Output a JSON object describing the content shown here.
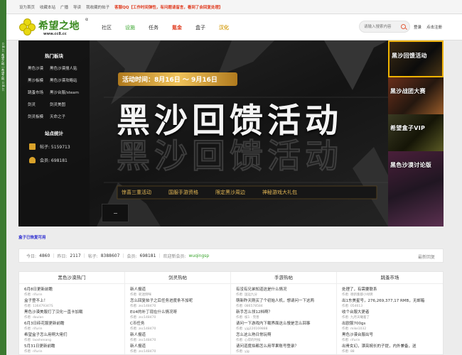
{
  "side_strip": {
    "text": "cc8.cc 希望之地 | 希望之地 cc8.cc"
  },
  "topbar": {
    "items": [
      "设为首页",
      "收藏本站",
      "广播",
      "导读",
      "我收藏的帖子"
    ],
    "notice": "客服QQ【工作时间弹性，有问题请留言，看到了会回复处理】"
  },
  "logo": {
    "name": "希望之地",
    "url": "www.cc8.cc",
    "alpha": "α"
  },
  "nav": {
    "items": [
      {
        "label": "社区",
        "style": "item"
      },
      {
        "label": "设施",
        "style": "active"
      },
      {
        "label": "任务",
        "style": "item"
      },
      {
        "label": "氪金",
        "style": "gold"
      },
      {
        "label": "盒子",
        "style": "item"
      },
      {
        "label": "汉化",
        "style": "hanhua"
      }
    ]
  },
  "search": {
    "placeholder": "请输入搜索内容"
  },
  "auth": {
    "login": "登录",
    "register": "点击注册"
  },
  "hotpanel": {
    "title": "热门板块",
    "links": [
      "黑色沙漠",
      "黑色沙漠搜人贴",
      "黑沙板模",
      "黑色沙漠攻略站",
      "跳蚤市场",
      "黑沙台服/steam",
      "剑灵",
      "剑灵美图",
      "剑灵板模",
      "天命之子"
    ],
    "stats_title": "站点统计",
    "posts_label": "帖子: 5159713",
    "members_label": "会员: 698181"
  },
  "hero": {
    "time": "活动时间：8月16日 ～ 9月16日",
    "headline": "黑沙回馈活动",
    "perks": [
      "惊喜三重活动",
      "国服手游资格",
      "限定黑沙周边",
      "神秘游戏大礼包"
    ]
  },
  "thumbs": [
    {
      "title": "黑沙回馈活动",
      "selected": true
    },
    {
      "title": "黑沙战团大赛",
      "selected": false
    },
    {
      "title": "希望盒子VIP",
      "selected": false
    },
    {
      "title": "黑色沙漠讨论版",
      "selected": false
    }
  ],
  "box_notice": "盒子已恢复可用",
  "statsbar": {
    "today_label": "今日:",
    "today": "4860",
    "yesterday_label": "昨日:",
    "yesterday": "2117",
    "posts_label": "帖子:",
    "posts": "8388607",
    "members_label": "会员:",
    "members": "698181",
    "welcome": "欢迎新会员:",
    "new_member": "wuqingsp",
    "latest": "最新回复"
  },
  "columns": [
    {
      "title": "黑色沙漠热门",
      "posts": [
        {
          "t": "6月8日更新前瞻",
          "a": "作者: rifurin"
        },
        {
          "t": "盒子登不上！",
          "a": "作者: 136479347S"
        },
        {
          "t": "黑色沙漠美服打了汉化一直卡加载",
          "a": "作者: doulan"
        },
        {
          "t": "6月3日砖花服更新前瞻",
          "a": "作者: rifurin"
        },
        {
          "t": "希望盒子怎么用啊大佬们",
          "a": "作者: laoshenang"
        },
        {
          "t": "5月31日更新前瞻",
          "a": "作者: rifurin"
        }
      ]
    },
    {
      "title": "剑灵热帖",
      "posts": [
        {
          "t": "新人报道",
          "a": "作者: 昵迷倒咪"
        },
        {
          "t": "怎么回复帖子之后任务进度条不加呢",
          "a": "作者: zsc148470"
        },
        {
          "t": "EU4的补丁现在什么情况呀",
          "a": "作者: zsc148470"
        },
        {
          "t": "C币任务",
          "a": "作者: zsc148470"
        },
        {
          "t": "新人报道",
          "a": "作者: zsc148470"
        },
        {
          "t": "新人报道",
          "a": "作者: zsc148470"
        }
      ]
    },
    {
      "title": "手游热帖",
      "posts": [
        {
          "t": "有没有兄弟知道这是什么情况",
          "a": "作者: 国运九分"
        },
        {
          "t": "萌新昨天刚买了个初始人机，想请问一下这两",
          "a": "作者: 086578584"
        },
        {
          "t": "新手怎么领12档啊？",
          "a": "作者: 核1 · 完善"
        },
        {
          "t": "请问一下游戏内下载界面这么慢是怎么回事",
          "a": "作者: yjg220169888"
        },
        {
          "t": "怎么这么熟日常玩啊",
          "a": "作者: 心得的时候"
        },
        {
          "t": "请问道度拟都怎么用苹果账号登录？",
          "a": "作者: yjg"
        }
      ]
    },
    {
      "title": "跳蚤市场",
      "posts": [
        {
          "t": "处理了，有需要联系",
          "a": "作者: 德新集都小绿牌"
        },
        {
          "t": "出1东美星号，276,269,377,17 RMB，无邮箱",
          "a": "作者: 054613"
        },
        {
          "t": "收个台服大更者",
          "a": "作者: 九月天曦着了"
        },
        {
          "t": "出欧服700gs",
          "a": "作者: mike1032"
        },
        {
          "t": "黑色沙漠台服出号",
          "a": "作者: rifurin"
        },
        {
          "t": "出骨女幻，漂亮婉长的子提，内外兼备，送",
          "a": "作者: 88"
        }
      ]
    }
  ],
  "colors": {
    "accent_green": "#3aa52e",
    "notice_red": "#e03b1f",
    "gold": "#d9a22a",
    "link_blue": "#2b2bd0"
  },
  "icons": [
    "search-icon",
    "clover-logo-icon",
    "posts-icon",
    "user-icon"
  ]
}
